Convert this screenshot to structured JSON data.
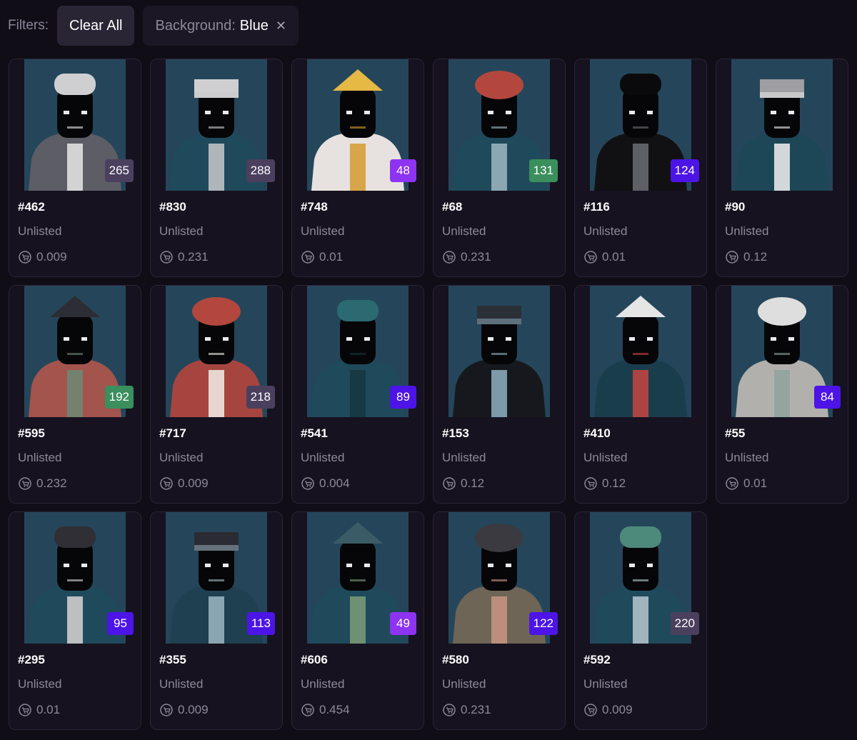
{
  "filters": {
    "label": "Filters:",
    "clear_all": "Clear All",
    "active": {
      "key": "Background:",
      "value": "Blue",
      "remove_icon": "close-icon"
    }
  },
  "colors": {
    "rank_gray": "#4b3f5e",
    "rank_purple": "#8d33f2",
    "rank_indigo": "#4c14e6",
    "rank_green": "#3a8f5c",
    "art_background": "#25465a"
  },
  "items": [
    {
      "id": "#462",
      "status": "Unlisted",
      "price": "0.009",
      "rank": "265",
      "rank_color": "gray",
      "palette": {
        "bg": "#25465a",
        "body": "#5d5d66",
        "head": "#cfcfd2",
        "accent": "#e8e8ea"
      }
    },
    {
      "id": "#830",
      "status": "Unlisted",
      "price": "0.231",
      "rank": "288",
      "rank_color": "gray",
      "palette": {
        "bg": "#25465a",
        "body": "#1f4a5c",
        "head": "#cfcfd2",
        "accent": "#c9c9c9"
      }
    },
    {
      "id": "#748",
      "status": "Unlisted",
      "price": "0.01",
      "rank": "48",
      "rank_color": "purple",
      "palette": {
        "bg": "#25465a",
        "body": "#e7e2e0",
        "head": "#e6b844",
        "accent": "#d59b2f"
      }
    },
    {
      "id": "#68",
      "status": "Unlisted",
      "price": "0.231",
      "rank": "131",
      "rank_color": "green",
      "palette": {
        "bg": "#25465a",
        "body": "#1f4a5c",
        "head": "#b3473d",
        "accent": "#9fb8c1"
      }
    },
    {
      "id": "#116",
      "status": "Unlisted",
      "price": "0.01",
      "rank": "124",
      "rank_color": "indigo",
      "palette": {
        "bg": "#25465a",
        "body": "#111114",
        "head": "#0a0a0c",
        "accent": "#6d6d74"
      }
    },
    {
      "id": "#90",
      "status": "Unlisted",
      "price": "0.12",
      "rank": "",
      "rank_color": "none",
      "palette": {
        "bg": "#25465a",
        "body": "#1d4656",
        "head": "#9e9ea3",
        "accent": "#f1f1f1"
      }
    },
    {
      "id": "#595",
      "status": "Unlisted",
      "price": "0.232",
      "rank": "192",
      "rank_color": "green",
      "palette": {
        "bg": "#25465a",
        "body": "#a3544d",
        "head": "#2d2d35",
        "accent": "#6c8a76"
      }
    },
    {
      "id": "#717",
      "status": "Unlisted",
      "price": "0.009",
      "rank": "218",
      "rank_color": "gray",
      "palette": {
        "bg": "#25465a",
        "body": "#a6453f",
        "head": "#b3473d",
        "accent": "#f2efe9"
      }
    },
    {
      "id": "#541",
      "status": "Unlisted",
      "price": "0.004",
      "rank": "89",
      "rank_color": "indigo",
      "palette": {
        "bg": "#25465a",
        "body": "#1f4a5c",
        "head": "#2a6a70",
        "accent": "#15363f"
      }
    },
    {
      "id": "#153",
      "status": "Unlisted",
      "price": "0.12",
      "rank": "",
      "rank_color": "none",
      "palette": {
        "bg": "#25465a",
        "body": "#17181d",
        "head": "#2b2f36",
        "accent": "#8fb1c1"
      }
    },
    {
      "id": "#410",
      "status": "Unlisted",
      "price": "0.12",
      "rank": "",
      "rank_color": "none",
      "palette": {
        "bg": "#25465a",
        "body": "#1a3d4c",
        "head": "#e5e5e5",
        "accent": "#c9453f"
      }
    },
    {
      "id": "#55",
      "status": "Unlisted",
      "price": "0.01",
      "rank": "84",
      "rank_color": "indigo",
      "palette": {
        "bg": "#25465a",
        "body": "#b2b0ad",
        "head": "#dedede",
        "accent": "#8ea39d"
      }
    },
    {
      "id": "#295",
      "status": "Unlisted",
      "price": "0.01",
      "rank": "95",
      "rank_color": "indigo",
      "palette": {
        "bg": "#25465a",
        "body": "#1f4a5c",
        "head": "#2f2f35",
        "accent": "#d9d4d2"
      }
    },
    {
      "id": "#355",
      "status": "Unlisted",
      "price": "0.009",
      "rank": "113",
      "rank_color": "indigo",
      "palette": {
        "bg": "#25465a",
        "body": "#1f4050",
        "head": "#2b2b33",
        "accent": "#9fb8c4"
      }
    },
    {
      "id": "#606",
      "status": "Unlisted",
      "price": "0.454",
      "rank": "49",
      "rank_color": "purple",
      "palette": {
        "bg": "#25465a",
        "body": "#1f4a5c",
        "head": "#3b5c66",
        "accent": "#7b9d75"
      }
    },
    {
      "id": "#580",
      "status": "Unlisted",
      "price": "0.231",
      "rank": "122",
      "rank_color": "indigo",
      "palette": {
        "bg": "#25465a",
        "body": "#6f6556",
        "head": "#3a3a40",
        "accent": "#c99683"
      }
    },
    {
      "id": "#592",
      "status": "Unlisted",
      "price": "0.009",
      "rank": "220",
      "rank_color": "gray",
      "palette": {
        "bg": "#25465a",
        "body": "#1f4a5c",
        "head": "#4d8a7c",
        "accent": "#b7c7cc"
      }
    }
  ]
}
